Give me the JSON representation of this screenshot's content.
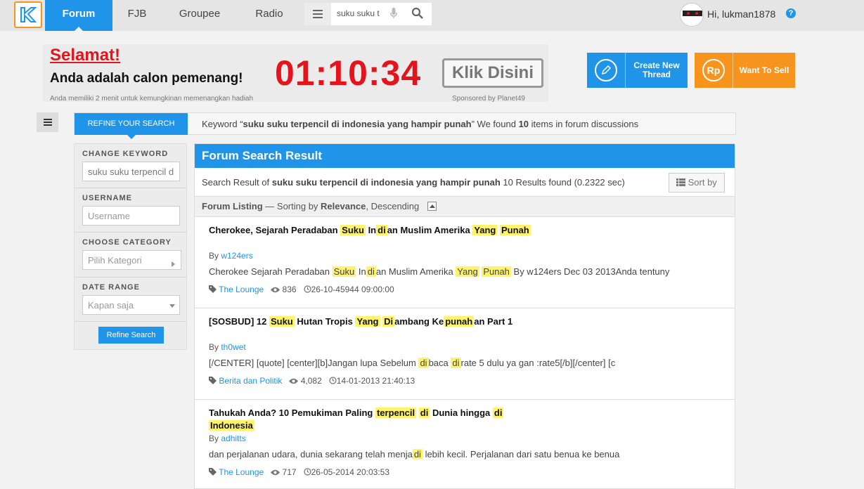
{
  "nav": {
    "logo_icon": "kaskus-logo-icon",
    "tabs": [
      "Forum",
      "FJB",
      "Groupee",
      "Radio"
    ],
    "search_value": "suku suku t",
    "user_greeting": "Hi, lukman1878",
    "help": "?"
  },
  "banner": {
    "headline": "Selamat!",
    "subline": "Anda adalah calon pemenang!",
    "timer": "01:10:34",
    "cta": "Klik Disini",
    "fine_print": "Anda memiliki 2 menit untuk kemungkinan memenangkan hadiah",
    "sponsor": "Sponsored by Planet49"
  },
  "actions": {
    "create_label": "Create New Thread",
    "sell_label": "Want To Sell",
    "sell_icon_text": "Rp"
  },
  "refine": {
    "tab_label": "REFINE YOUR SEARCH",
    "keyword_prefix": "Keyword “",
    "keyword": "suku suku terpencil di indonesia yang hampir punah",
    "keyword_mid": "” We found ",
    "count": "10",
    "keyword_suffix": " items in forum discussions"
  },
  "filter": {
    "change_keyword_label": "CHANGE KEYWORD",
    "keyword_value": "suku suku terpencil d",
    "username_label": "USERNAME",
    "username_placeholder": "Username",
    "category_label": "CHOOSE CATEGORY",
    "category_placeholder": "Pilih Kategori",
    "date_label": "DATE RANGE",
    "date_value": "Kapan saja",
    "button": "Refine Search"
  },
  "results": {
    "header": "Forum Search Result",
    "summary_prefix": "Search Result of ",
    "summary_keyword": "suku suku terpencil di indonesia yang hampir punah",
    "summary_suffix": " 10 Results found (0.2322 sec)",
    "sort_label": "Sort by",
    "listing_label": "Forum Listing",
    "listing_dash": " — Sorting by ",
    "listing_sort": "Relevance",
    "listing_order": ", Descending",
    "by_label": "By ",
    "items": [
      {
        "title_parts": [
          {
            "t": "Cherokee, Sejarah Peradaban ",
            "h": false
          },
          {
            "t": "Suku",
            "h": true
          },
          {
            "t": " In",
            "h": false
          },
          {
            "t": "di",
            "h": true
          },
          {
            "t": "an Muslim Amerika ",
            "h": false
          },
          {
            "t": "Yang",
            "h": true
          },
          {
            "t": " ",
            "h": false
          },
          {
            "t": "Punah",
            "h": true
          }
        ],
        "author": "w124ers",
        "snippet_parts": [
          {
            "t": "Cherokee Sejarah Peradaban ",
            "h": false
          },
          {
            "t": "Suku",
            "h": true
          },
          {
            "t": " In",
            "h": false
          },
          {
            "t": "di",
            "h": true
          },
          {
            "t": "an Muslim Amerika ",
            "h": false
          },
          {
            "t": "Yang",
            "h": true
          },
          {
            "t": " ",
            "h": false
          },
          {
            "t": "Punah",
            "h": true
          },
          {
            "t": " By w124ers Dec 03 2013Anda tentuny",
            "h": false
          }
        ],
        "category": "The Lounge",
        "views": "836",
        "date": "26-10-45944 09:00:00"
      },
      {
        "title_parts": [
          {
            "t": "[SOSBUD] 12 ",
            "h": false
          },
          {
            "t": "Suku",
            "h": true
          },
          {
            "t": " Hutan Tropis ",
            "h": false
          },
          {
            "t": "Yang",
            "h": true
          },
          {
            "t": " ",
            "h": false
          },
          {
            "t": "Di",
            "h": true
          },
          {
            "t": "ambang Ke",
            "h": false
          },
          {
            "t": "punah",
            "h": true
          },
          {
            "t": "an Part 1",
            "h": false
          }
        ],
        "author": "th0wet",
        "snippet_parts": [
          {
            "t": "[/CENTER] [quote] [center][b]Jangan lupa Sebelum ",
            "h": false
          },
          {
            "t": "di",
            "h": true
          },
          {
            "t": "baca ",
            "h": false
          },
          {
            "t": "di",
            "h": true
          },
          {
            "t": "rate 5 dulu ya gan :rate5[/b][/center] [c",
            "h": false
          }
        ],
        "category": "Berita dan Politik",
        "views": "4,082",
        "date": "14-01-2013 21:40:13"
      },
      {
        "title_parts": [
          {
            "t": "Tahukah Anda? 10 Pemukiman Paling ",
            "h": false
          },
          {
            "t": "terpencil",
            "h": true
          },
          {
            "t": " ",
            "h": false
          },
          {
            "t": "di",
            "h": true
          },
          {
            "t": " Dunia hingga ",
            "h": false
          },
          {
            "t": "di",
            "h": true
          },
          {
            "t": " ",
            "h": false
          },
          {
            "t": "Indonesia",
            "h": true
          }
        ],
        "author": "adhitts",
        "snippet_parts": [
          {
            "t": "dan perjalanan udara, dunia sekarang telah menja",
            "h": false
          },
          {
            "t": "di",
            "h": true
          },
          {
            "t": " lebih kecil. Perjalanan dari satu benua ke benua",
            "h": false
          }
        ],
        "category": "The Lounge",
        "views": "717",
        "date": "26-05-2014 20:03:53"
      }
    ]
  },
  "colors": {
    "brand_blue": "#1f94e8",
    "brand_orange": "#f7941d",
    "highlight": "#fff36b",
    "alert_red": "#e3141b"
  }
}
